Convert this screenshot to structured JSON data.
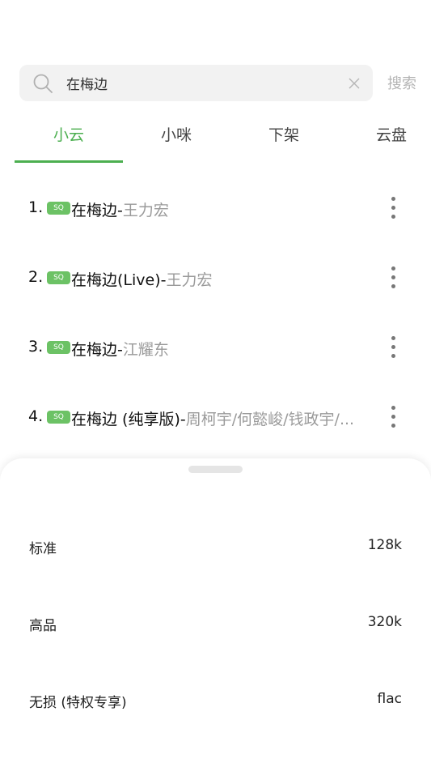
{
  "search": {
    "value": "在梅边",
    "button_label": "搜索"
  },
  "tabs": [
    {
      "label": "小云",
      "active": true
    },
    {
      "label": "小咪",
      "active": false
    },
    {
      "label": "下架",
      "active": false
    },
    {
      "label": "云盘",
      "active": false
    }
  ],
  "accent_color": "#4caf50",
  "songs": [
    {
      "index": "1.",
      "badge": "SQ",
      "title": "在梅边",
      "sep": "-",
      "artist": "王力宏"
    },
    {
      "index": "2.",
      "badge": "SQ",
      "title": "在梅边(Live)",
      "sep": "-",
      "artist": "王力宏"
    },
    {
      "index": "3.",
      "badge": "SQ",
      "title": "在梅边",
      "sep": "-",
      "artist": "江耀东"
    },
    {
      "index": "4.",
      "badge": "SQ",
      "title": "在梅边 (纯享版)",
      "sep": "-",
      "artist": "周柯宇/何懿峻/钱政宇/..."
    }
  ],
  "quality_sheet": {
    "options": [
      {
        "label": "标准",
        "rate": "128k"
      },
      {
        "label": "高品",
        "rate": "320k"
      },
      {
        "label": "无损 (特权专享)",
        "rate": "flac"
      }
    ]
  }
}
